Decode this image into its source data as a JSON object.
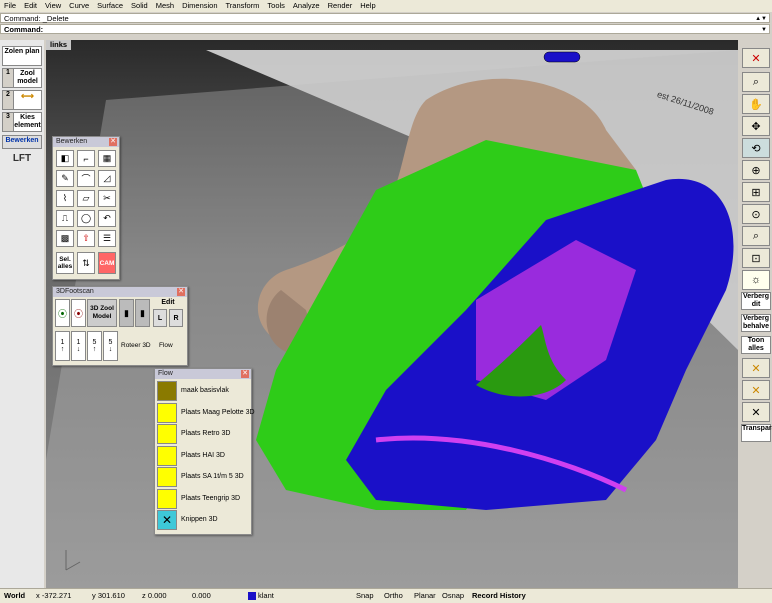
{
  "menu": [
    "File",
    "Edit",
    "View",
    "Curve",
    "Surface",
    "Solid",
    "Mesh",
    "Dimension",
    "Transform",
    "Tools",
    "Analyze",
    "Render",
    "Help"
  ],
  "command_history": "Command: _Delete",
  "command_prompt": "Command:",
  "viewport": {
    "title": "links",
    "stamp": "est 26/11/2008"
  },
  "left_panel": {
    "zolen_plan": "Zolen plan",
    "step1_num": "1",
    "step1_label": "Zool model",
    "step2_num": "2",
    "step3_num": "3",
    "step3_label": "Kies element",
    "bewerken": "Bewerken",
    "logo": "LFT"
  },
  "bewerken_panel": {
    "title": "Bewerken",
    "sel_alles": "Sel. alles",
    "cam": "CAM"
  },
  "footscan_panel": {
    "title": "3DFootscan",
    "zool_model": "3D Zool Model",
    "edit": "Edit",
    "l": "L",
    "r": "R",
    "step_labels": [
      "1",
      "1",
      "5",
      "5"
    ],
    "roteer": "Roteer 3D",
    "flow": "Flow"
  },
  "flow_panel": {
    "title": "Flow",
    "items": [
      {
        "label": "maak basisvlak",
        "color": "#8a7a00"
      },
      {
        "label": "Plaats Maag Pelotte 3D",
        "color": "#ffff00"
      },
      {
        "label": "Plaats Retro 3D",
        "color": "#ffff00"
      },
      {
        "label": "Plaats HAI 3D",
        "color": "#ffff00"
      },
      {
        "label": "Plaats SA 1t/m 5 3D",
        "color": "#ffff00"
      },
      {
        "label": "Plaats Teengrip 3D",
        "color": "#ffff00"
      },
      {
        "label": "Knippen 3D",
        "color": "#3ec8d8"
      }
    ]
  },
  "right_toolbar": {
    "verberg_dit": "Verberg dit",
    "verberg_behalve": "Verberg behalve",
    "toon_alles": "Toon alles",
    "transparantie": "Transparantie"
  },
  "status_bar": {
    "world": "World",
    "x": "x -372.271",
    "y": "y 301.610",
    "z": "z 0.000",
    "val": "0.000",
    "layer": "klant",
    "snap": "Snap",
    "ortho": "Ortho",
    "planar": "Planar",
    "osnap": "Osnap",
    "record": "Record History"
  },
  "colors": {
    "insole_blue": "#1a10c8",
    "heel_green": "#2ecc18",
    "accent_purple": "#b030e0",
    "foot_skin": "#b49882"
  }
}
